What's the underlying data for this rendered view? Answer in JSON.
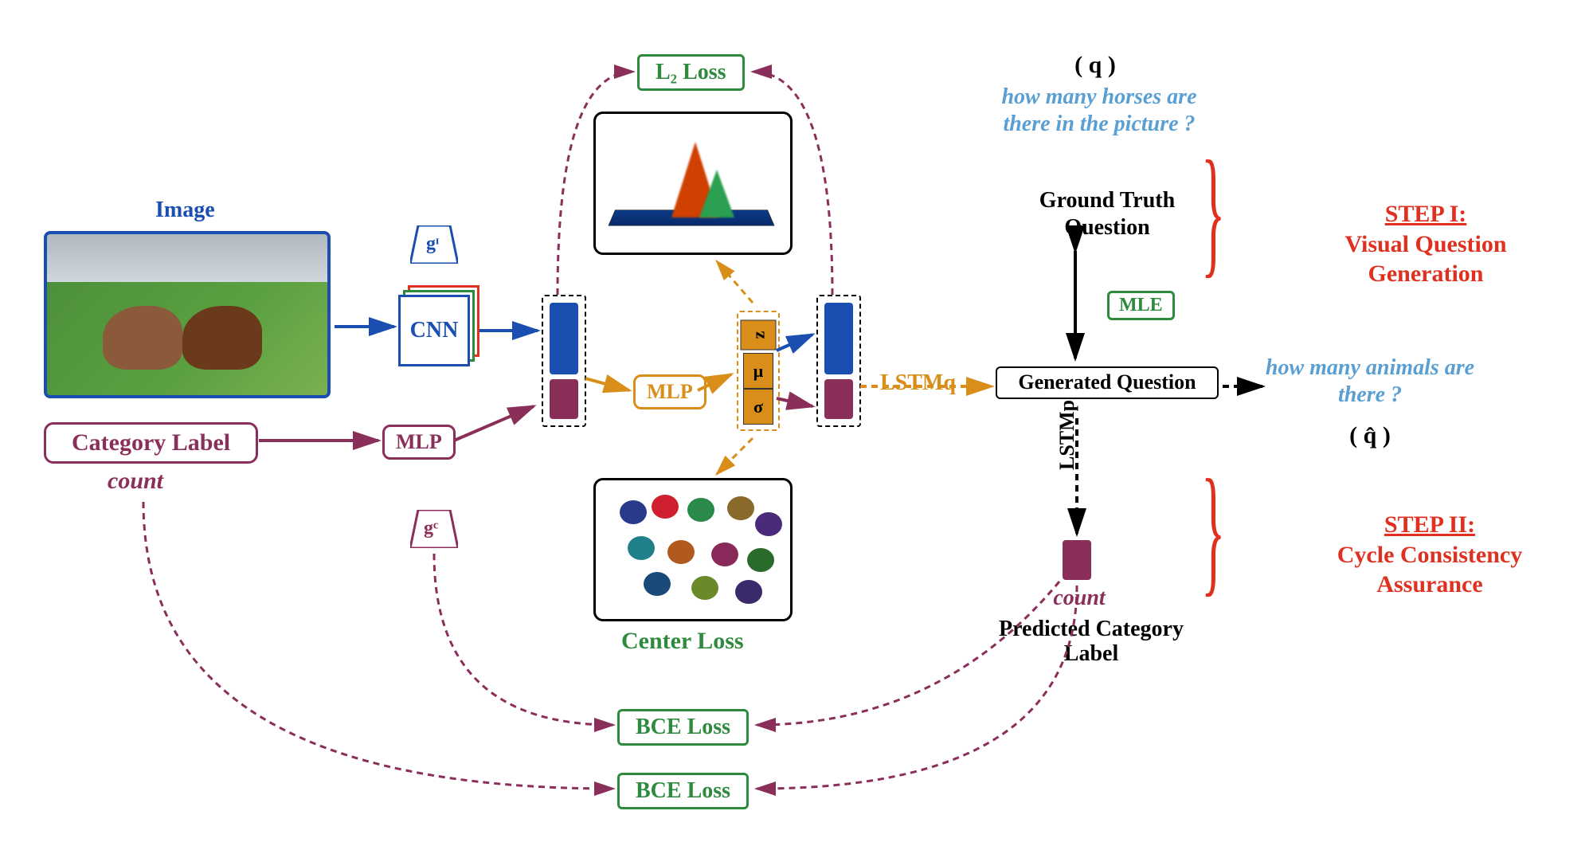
{
  "image_label": "Image",
  "category_label": "Category Label",
  "category_value": "count",
  "encoders": {
    "gi": "gᶦ",
    "gc": "gᶜ"
  },
  "blocks": {
    "cnn": "CNN",
    "mlp1": "MLP",
    "mlp2": "MLP",
    "z": "z",
    "mu": "μ",
    "sigma": "σ",
    "lstm_q": "LSTMq",
    "lstm_p": "LSTMp"
  },
  "losses": {
    "l2": "L₂ Loss",
    "center": "Center Loss",
    "mle": "MLE",
    "bce1": "BCE Loss",
    "bce2": "BCE Loss"
  },
  "questions": {
    "q_symbol": "( q )",
    "qhat_symbol": "( q̂ )",
    "gt_text": "how many horses are there in the picture ?",
    "gt_label": "Ground Truth Question",
    "gen_label": "Generated Question",
    "gen_text": "how many animals are there ?"
  },
  "predicted": {
    "value": "count",
    "label": "Predicted Category Label"
  },
  "steps": {
    "s1_title": "STEP I:",
    "s1_text": "Visual Question Generation",
    "s2_title": "STEP II:",
    "s2_text": "Cycle Consistency Assurance"
  }
}
